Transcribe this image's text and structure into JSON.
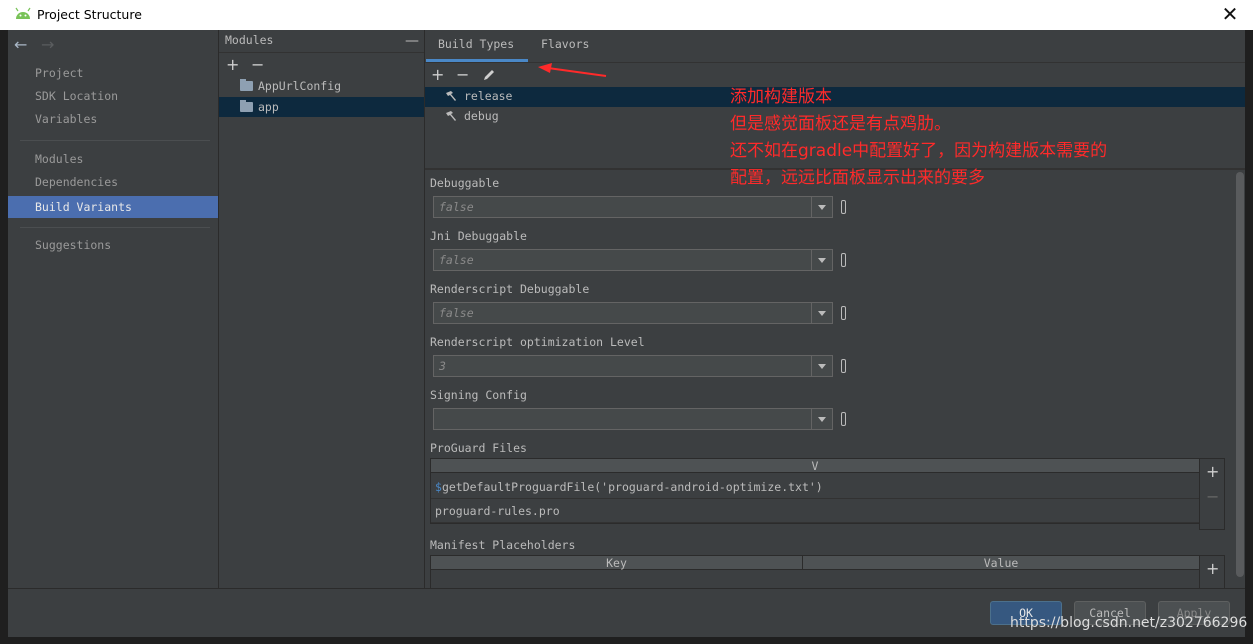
{
  "window": {
    "title": "Project Structure"
  },
  "nav": {
    "items": [
      {
        "label": "Project"
      },
      {
        "label": "SDK Location"
      },
      {
        "label": "Variables"
      },
      {
        "label": "Modules"
      },
      {
        "label": "Dependencies"
      },
      {
        "label": "Build Variants"
      },
      {
        "label": "Suggestions"
      }
    ],
    "selected": "Build Variants"
  },
  "modules": {
    "title": "Modules",
    "items": [
      {
        "label": "AppUrlConfig"
      },
      {
        "label": "app"
      }
    ],
    "selected": "app"
  },
  "tabs": [
    {
      "label": "Build Types"
    },
    {
      "label": "Flavors"
    }
  ],
  "build_types": {
    "items": [
      {
        "label": "release"
      },
      {
        "label": "debug"
      }
    ],
    "selected": "release"
  },
  "fields": [
    {
      "label": "Debuggable",
      "value": "false"
    },
    {
      "label": "Jni Debuggable",
      "value": "false"
    },
    {
      "label": "Renderscript Debuggable",
      "value": "false"
    },
    {
      "label": "Renderscript optimization Level",
      "value": "3"
    },
    {
      "label": "Signing Config",
      "value": ""
    }
  ],
  "proguard": {
    "label": "ProGuard Files",
    "column_header": "V",
    "rows": [
      {
        "prefix": "$",
        "text": "getDefaultProguardFile('proguard-android-optimize.txt')"
      },
      {
        "prefix": "",
        "text": "proguard-rules.pro"
      }
    ]
  },
  "manifest": {
    "label": "Manifest Placeholders",
    "columns": [
      "Key",
      "Value"
    ]
  },
  "buttons": {
    "ok": "OK",
    "cancel": "Cancel",
    "apply": "Apply"
  },
  "annotation": {
    "lines": [
      "添加构建版本",
      "但是感觉面板还是有点鸡肋。",
      "还不如在gradle中配置好了，因为构建版本需要的",
      "配置，远远比面板显示出来的要多"
    ]
  },
  "watermark": "https://blog.csdn.net/z302766296",
  "colors": {
    "selection_nav": "#4b6eaf",
    "selection_list": "#0d293e",
    "tab_underline": "#4a88c7",
    "annotation": "#ff2a2a",
    "ok_button": "#365880"
  },
  "icons": [
    "android-icon",
    "close-icon",
    "back-arrow-icon",
    "forward-arrow-icon",
    "folder-icon",
    "hammer-icon",
    "add-icon",
    "remove-icon",
    "edit-icon",
    "dropdown-arrow-icon"
  ]
}
